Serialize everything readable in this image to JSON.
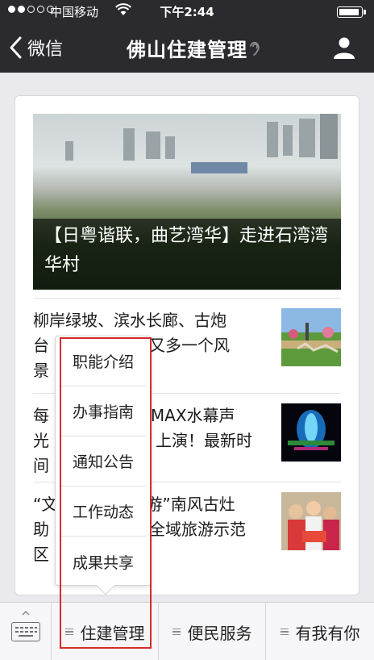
{
  "status_bar": {
    "carrier": "中国移动",
    "time": "下午2:44",
    "signal_dots_filled": 2,
    "signal_dots_total": 5,
    "wifi_icon": "wifi-icon",
    "battery_icon": "battery-icon"
  },
  "nav": {
    "back_label": "微信",
    "title": "佛山住建管理",
    "profile_icon": "person-icon"
  },
  "articles": {
    "hero": {
      "caption": "【日粤谐联，曲艺湾华】走进石湾湾华村"
    },
    "items": [
      {
        "text_visible": "柳岸绿坡、滨水长廊、古炮台……又多一个风景……",
        "line1": "柳岸绿坡、滨水长廊、古炮",
        "line2": "台",
        "line2b": "又多一个风",
        "line3": "景"
      },
      {
        "line1": "每",
        "line1b": "IMAX水幕声",
        "line2": "光",
        "line2b": "上演！最新时",
        "line3": "间"
      },
      {
        "line1": "“文",
        "line1b": "游”南风古灶",
        "line2": "助",
        "line2b": "全域旅游示范",
        "line3": "区"
      }
    ]
  },
  "popup_menu": {
    "items": [
      "职能介绍",
      "办事指南",
      "通知公告",
      "工作动态",
      "成果共享"
    ]
  },
  "bottom_menu": {
    "items": [
      "住建管理",
      "便民服务",
      "有我有你"
    ]
  },
  "colors": {
    "bar_dark": "#2b2b2f",
    "highlight": "#d62b2b"
  }
}
